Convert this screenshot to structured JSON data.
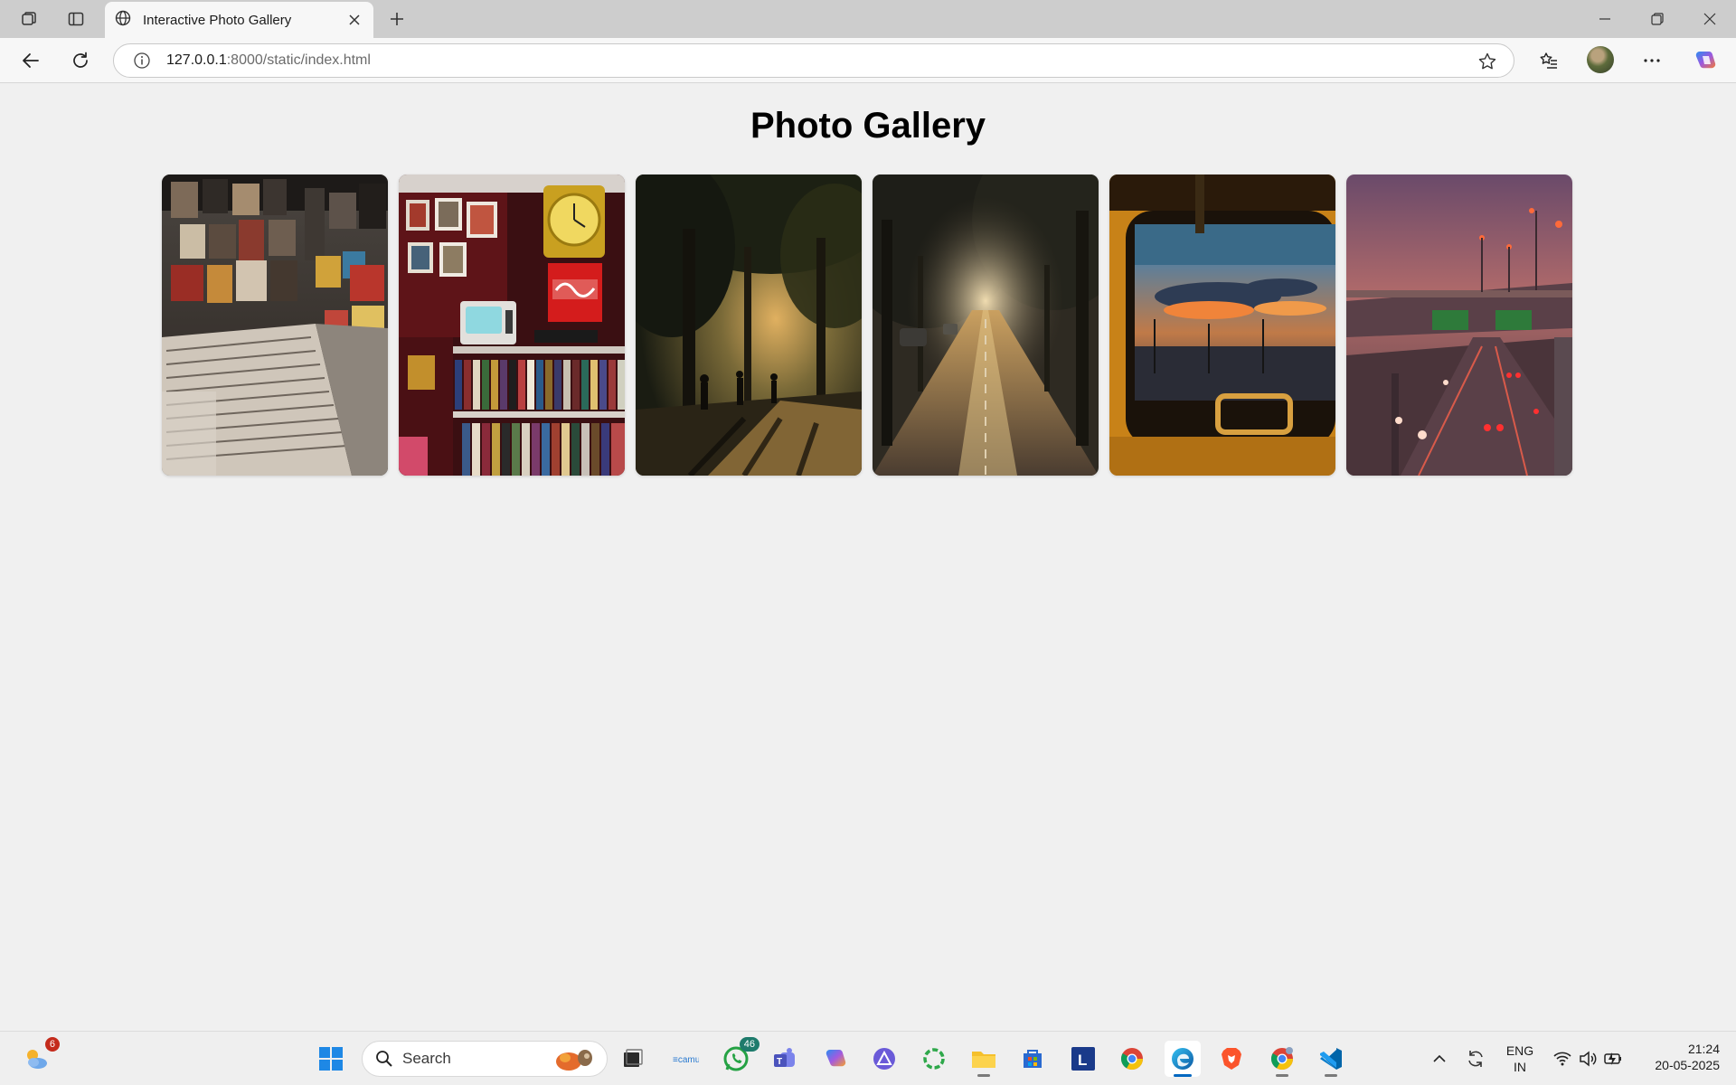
{
  "browser": {
    "tab_title": "Interactive Photo Gallery",
    "url_host": "127.0.0.1",
    "url_rest": ":8000/static/index.html"
  },
  "page": {
    "heading": "Photo Gallery",
    "photos": [
      {
        "name": "record-store"
      },
      {
        "name": "vintage-shop"
      },
      {
        "name": "park-sunset"
      },
      {
        "name": "tree-lined-road"
      },
      {
        "name": "bus-window-sunset"
      },
      {
        "name": "highway-dusk"
      }
    ]
  },
  "taskbar": {
    "weather_badge": "6",
    "search_label": "Search",
    "whatsapp_badge": "46",
    "lang_line1": "ENG",
    "lang_line2": "IN",
    "time": "21:24",
    "date": "20-05-2025"
  }
}
